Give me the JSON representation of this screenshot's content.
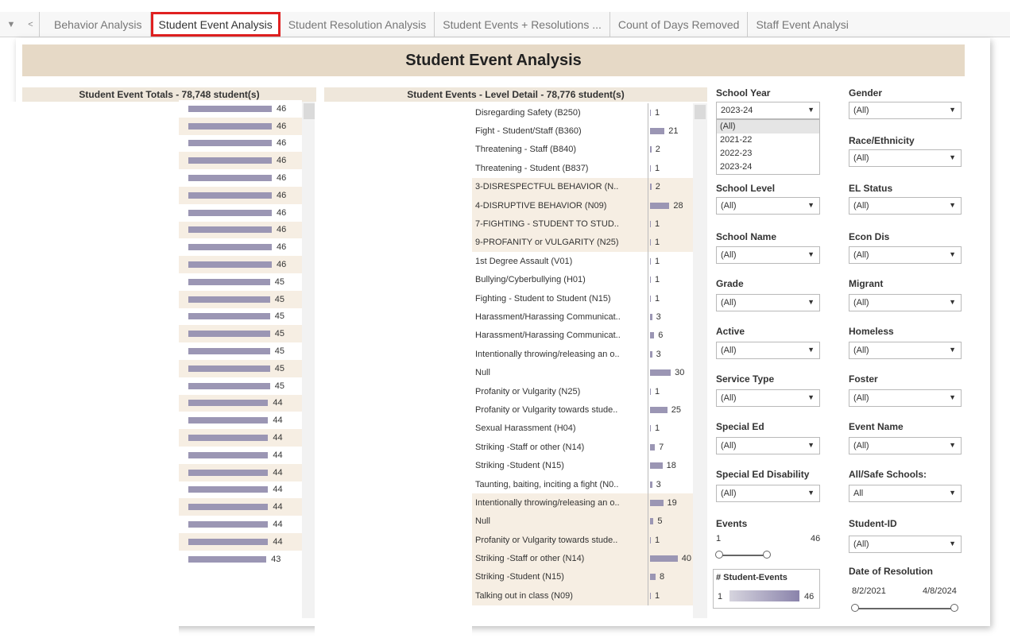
{
  "tabs": [
    {
      "label": "Behavior Analysis"
    },
    {
      "label": "Student Event Analysis"
    },
    {
      "label": "Student Resolution Analysis"
    },
    {
      "label": "Student Events + Resolutions ..."
    },
    {
      "label": "Count of Days Removed"
    },
    {
      "label": "Staff Event Analysi"
    }
  ],
  "dashboard_title": "Student Event Analysis",
  "totals": {
    "title_bold": "Student Event Totals",
    "title_count": " - 78,748 student(s)",
    "values": [
      46,
      46,
      46,
      46,
      46,
      46,
      46,
      46,
      46,
      46,
      45,
      45,
      45,
      45,
      45,
      45,
      45,
      44,
      44,
      44,
      44,
      44,
      44,
      44,
      44,
      44,
      43
    ],
    "max": 46
  },
  "detail": {
    "title_bold": "Student Events",
    "title_rest": " - Level Detail - 78,776 student(s)",
    "max": 46,
    "rows": [
      {
        "label": "Disregarding Safety (B250)",
        "value": 1
      },
      {
        "label": "Fight - Student/Staff (B360)",
        "value": 21
      },
      {
        "label": "Threatening - Staff (B840)",
        "value": 2
      },
      {
        "label": "Threatening - Student (B837)",
        "value": 1
      },
      {
        "label": "3-DISRESPECTFUL BEHAVIOR (N..",
        "value": 2
      },
      {
        "label": "4-DISRUPTIVE BEHAVIOR (N09)",
        "value": 28
      },
      {
        "label": "7-FIGHTING - STUDENT TO STUD..",
        "value": 1
      },
      {
        "label": "9-PROFANITY or VULGARITY (N25)",
        "value": 1
      },
      {
        "label": "1st Degree Assault (V01)",
        "value": 1
      },
      {
        "label": "Bullying/Cyberbullying (H01)",
        "value": 1
      },
      {
        "label": "Fighting - Student to Student (N15)",
        "value": 1
      },
      {
        "label": "Harassment/Harassing Communicat..",
        "value": 3
      },
      {
        "label": "Harassment/Harassing Communicat..",
        "value": 6
      },
      {
        "label": "Intentionally throwing/releasing an o..",
        "value": 3
      },
      {
        "label": "Null",
        "value": 30
      },
      {
        "label": "Profanity or Vulgarity (N25)",
        "value": 1
      },
      {
        "label": "Profanity or Vulgarity towards stude..",
        "value": 25
      },
      {
        "label": "Sexual Harassment (H04)",
        "value": 1
      },
      {
        "label": "Striking -Staff or other (N14)",
        "value": 7
      },
      {
        "label": "Striking -Student (N15)",
        "value": 18
      },
      {
        "label": "Taunting, baiting, inciting a fight (N0..",
        "value": 3
      },
      {
        "label": "Intentionally throwing/releasing an o..",
        "value": 19
      },
      {
        "label": "Null",
        "value": 5
      },
      {
        "label": "Profanity or Vulgarity towards stude..",
        "value": 1
      },
      {
        "label": "Striking -Staff or other (N14)",
        "value": 40
      },
      {
        "label": "Striking -Student (N15)",
        "value": 8
      },
      {
        "label": "Talking out in class (N09)",
        "value": 1
      }
    ]
  },
  "filters": {
    "school_year": {
      "label": "School Year",
      "value": "2023-24",
      "options": [
        "(All)",
        "2021-22",
        "2022-23",
        "2023-24"
      ]
    },
    "gender": {
      "label": "Gender",
      "value": "(All)"
    },
    "race": {
      "label": "Race/Ethnicity",
      "value": "(All)"
    },
    "school_level": {
      "label": "School Level",
      "value": "(All)"
    },
    "el_status": {
      "label": "EL Status",
      "value": "(All)"
    },
    "school_name": {
      "label": "School Name",
      "value": "(All)"
    },
    "econ_dis": {
      "label": "Econ Dis",
      "value": "(All)"
    },
    "grade": {
      "label": "Grade",
      "value": "(All)"
    },
    "migrant": {
      "label": "Migrant",
      "value": "(All)"
    },
    "active": {
      "label": "Active",
      "value": "(All)"
    },
    "homeless": {
      "label": "Homeless",
      "value": "(All)"
    },
    "service_type": {
      "label": "Service Type",
      "value": "(All)"
    },
    "foster": {
      "label": "Foster",
      "value": "(All)"
    },
    "special_ed": {
      "label": "Special Ed",
      "value": "(All)"
    },
    "event_name": {
      "label": "Event Name",
      "value": "(All)"
    },
    "sped_disability": {
      "label": "Special Ed Disability",
      "value": "(All)"
    },
    "all_safe_schools": {
      "label": "All/Safe Schools:",
      "value": "All"
    },
    "events": {
      "label": "Events",
      "min": "1",
      "max": "46"
    },
    "student_id": {
      "label": "Student-ID",
      "value": "(All)"
    },
    "date_resolution": {
      "label": "Date of Resolution",
      "start": "8/2/2021",
      "end": "4/8/2024"
    }
  },
  "legend": {
    "title": "# Student-Events",
    "min": "1",
    "max": "46"
  },
  "colors": {
    "bar": "#9b96b4",
    "banner": "#e6d9c6",
    "highlight": "#e02020"
  }
}
